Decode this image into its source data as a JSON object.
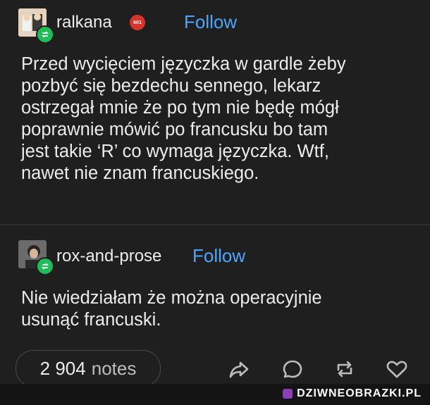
{
  "post": {
    "author": "ralkana",
    "author_badge": "601",
    "follow_label": "Follow",
    "text_lines": [
      "Przed wycięciem języczka w gardle żeby",
      "pozbyć się bezdechu sennego, lekarz",
      "ostrzegał mnie że po tym nie będę mógł",
      "poprawnie mówić po francusku bo tam",
      "jest takie ‘R’ co wymaga języczka. Wtf,",
      "nawet nie znam francuskiego."
    ]
  },
  "reply": {
    "author": "rox-and-prose",
    "follow_label": "Follow",
    "text_lines": [
      "Nie wiedziałam że można operacyjnie",
      "usunąć francuski."
    ]
  },
  "footer": {
    "notes_count": "2 904",
    "notes_label": "notes",
    "actions": [
      "share-icon",
      "comment-icon",
      "reblog-icon",
      "like-icon"
    ]
  },
  "watermark": "DZIWNEOBRAZKI.PL",
  "colors": {
    "background": "#1f1f1f",
    "follow": "#4aa7ff",
    "reblog_badge": "#1fbd58",
    "badge": "#d8342c"
  }
}
